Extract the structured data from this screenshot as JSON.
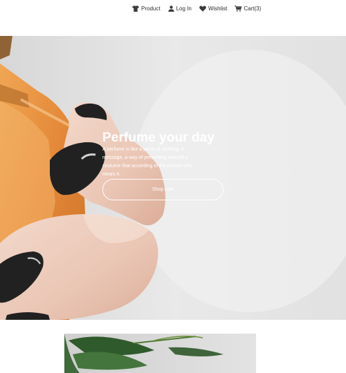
{
  "nav": {
    "items": [
      {
        "label": "Product",
        "icon": "shirt-icon"
      },
      {
        "label": "Log In",
        "icon": "user-icon"
      },
      {
        "label": "Wishlist",
        "icon": "heart-icon"
      },
      {
        "label": "Cart(3)",
        "icon": "cart-icon"
      }
    ]
  },
  "hero": {
    "title": "Perfume your day",
    "description": "A perfume is like a piece of clothing, a message, a way of presenting oneself a costume that according to the person who wears it.",
    "button_label": "Shop now"
  },
  "colors": {
    "nav_text": "#2b2b2b",
    "hero_text": "#ffffff",
    "nail_polish": "#141414",
    "bottle_amber": "#e08a32"
  }
}
